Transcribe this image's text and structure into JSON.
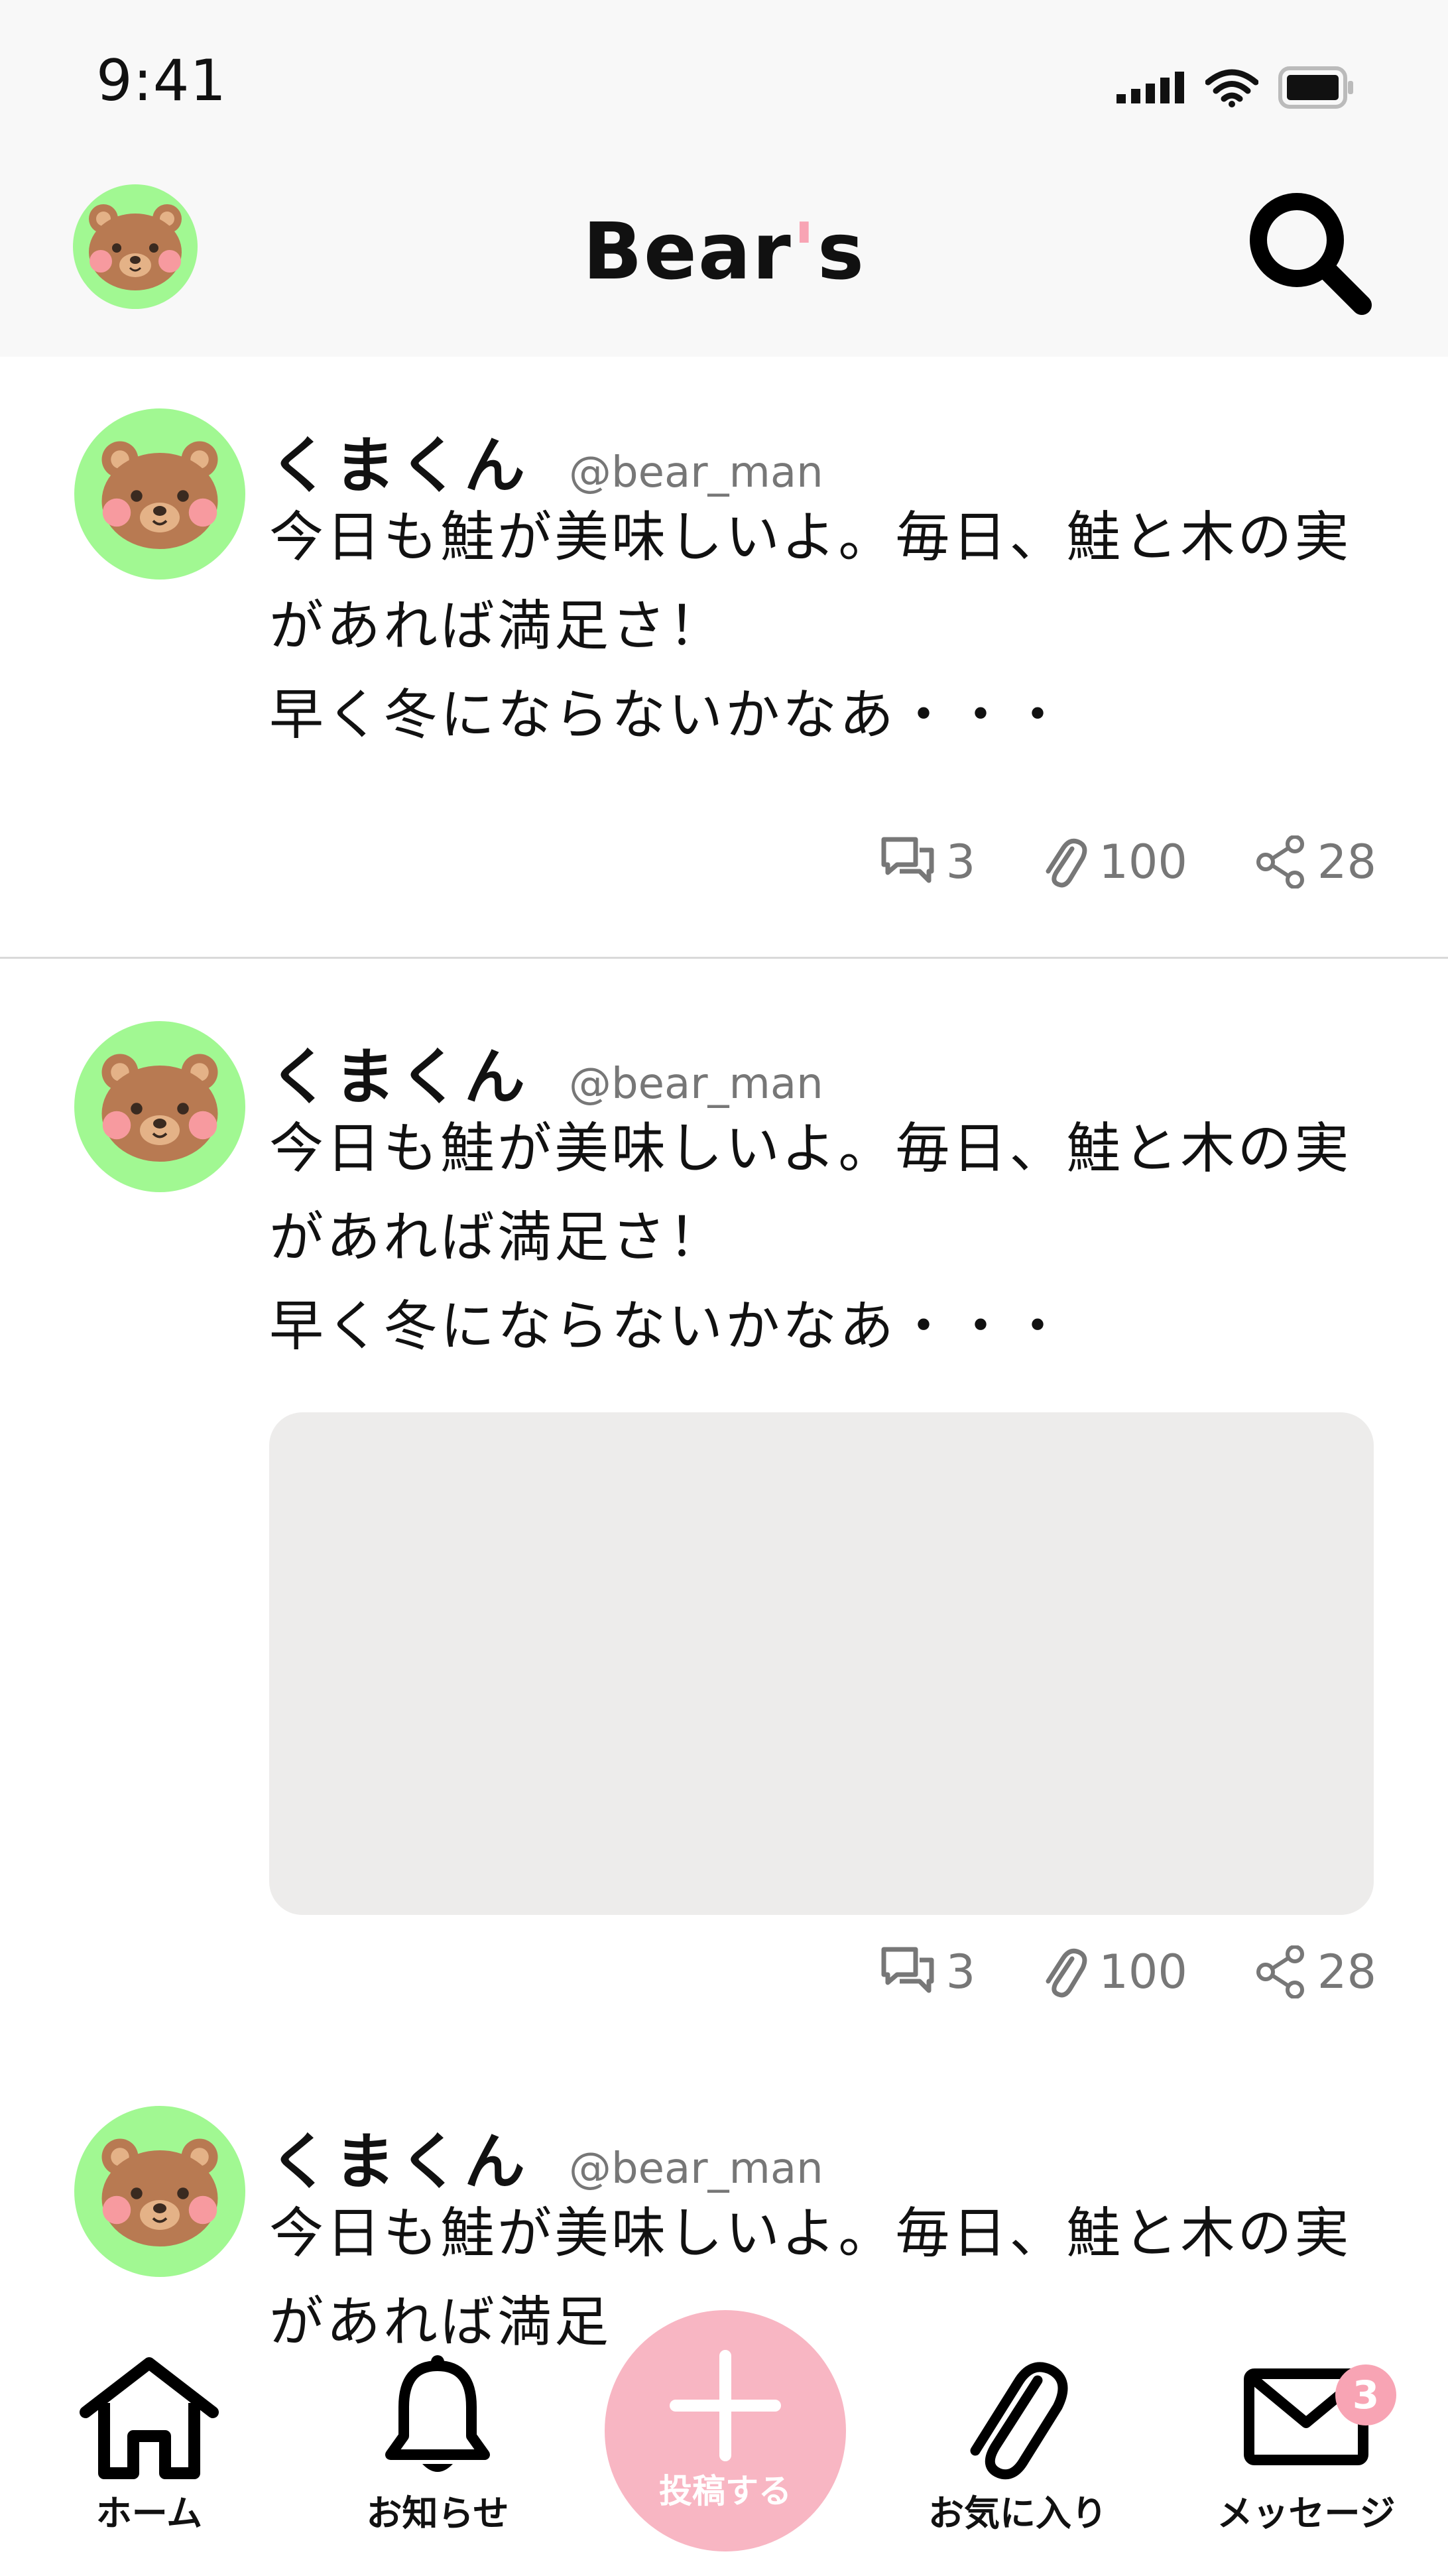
{
  "status_bar": {
    "time": "9:41"
  },
  "header": {
    "title_pre": "Bear",
    "title_apos": "'",
    "title_post": "s"
  },
  "posts": [
    {
      "name": "くまくん",
      "handle": "@bear_man",
      "lines": [
        "今日も鮭が美味しいよ。毎日、鮭と木の実",
        "があれば満足さ！",
        "早く冬にならないかなあ・・・"
      ],
      "comments": "3",
      "clips": "100",
      "shares": "28"
    },
    {
      "name": "くまくん",
      "handle": "@bear_man",
      "lines": [
        "今日も鮭が美味しいよ。毎日、鮭と木の実",
        "があれば満足さ！",
        "早く冬にならないかなあ・・・"
      ],
      "comments": "3",
      "clips": "100",
      "shares": "28"
    },
    {
      "name": "くまくん",
      "handle": "@bear_man",
      "lines": [
        "今日も鮭が美味しいよ。毎日、鮭と木の実",
        "があれば満足"
      ]
    }
  ],
  "tabs": {
    "home": "ホーム",
    "notifications": "お知らせ",
    "post": "投稿する",
    "favorites": "お気に入り",
    "messages": "メッセージ",
    "messages_badge": "3"
  },
  "colors": {
    "avatar_bg": "#a1f892",
    "accent_pink": "#f8a4b4",
    "fab_bg": "#f8b6c3",
    "media_placeholder": "#edeceb"
  }
}
